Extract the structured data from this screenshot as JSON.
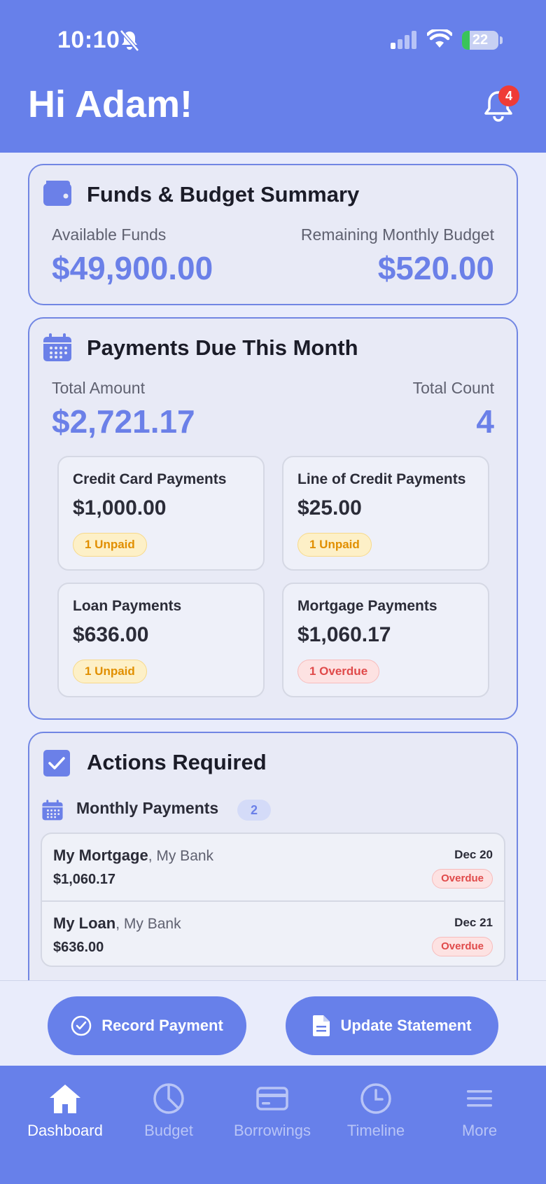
{
  "status_bar": {
    "time": "10:10",
    "battery": "22"
  },
  "header": {
    "greeting": "Hi Adam!",
    "notification_count": "4"
  },
  "summary": {
    "title": "Funds & Budget Summary",
    "available_label": "Available Funds",
    "available_value": "$49,900.00",
    "remaining_label": "Remaining Monthly Budget",
    "remaining_value": "$520.00"
  },
  "payments_due": {
    "title": "Payments Due This Month",
    "total_amount_label": "Total Amount",
    "total_amount_value": "$2,721.17",
    "total_count_label": "Total Count",
    "total_count_value": "4",
    "categories": [
      {
        "label": "Credit Card Payments",
        "amount": "$1,000.00",
        "status": "1 Unpaid",
        "status_type": "unpaid"
      },
      {
        "label": "Line of Credit Payments",
        "amount": "$25.00",
        "status": "1 Unpaid",
        "status_type": "unpaid"
      },
      {
        "label": "Loan Payments",
        "amount": "$636.00",
        "status": "1 Unpaid",
        "status_type": "unpaid"
      },
      {
        "label": "Mortgage Payments",
        "amount": "$1,060.17",
        "status": "1 Overdue",
        "status_type": "overdue"
      }
    ]
  },
  "actions": {
    "title": "Actions Required",
    "section_label": "Monthly Payments",
    "section_count": "2",
    "items": [
      {
        "name": "My Mortgage",
        "institution": ", My Bank",
        "amount": "$1,060.17",
        "date": "Dec 20",
        "status": "Overdue"
      },
      {
        "name": "My Loan",
        "institution": ", My Bank",
        "amount": "$636.00",
        "date": "Dec 21",
        "status": "Overdue"
      }
    ]
  },
  "buttons": {
    "record_payment": "Record Payment",
    "update_statement": "Update Statement"
  },
  "tabs": [
    {
      "label": "Dashboard",
      "icon": "home-icon",
      "active": true
    },
    {
      "label": "Budget",
      "icon": "pie-chart-icon",
      "active": false
    },
    {
      "label": "Borrowings",
      "icon": "credit-card-icon",
      "active": false
    },
    {
      "label": "Timeline",
      "icon": "clock-icon",
      "active": false
    },
    {
      "label": "More",
      "icon": "menu-icon",
      "active": false
    }
  ],
  "colors": {
    "primary": "#6780ea",
    "overdue": "#e04a4a",
    "unpaid": "#e18f00",
    "badge": "#ef3b36"
  }
}
